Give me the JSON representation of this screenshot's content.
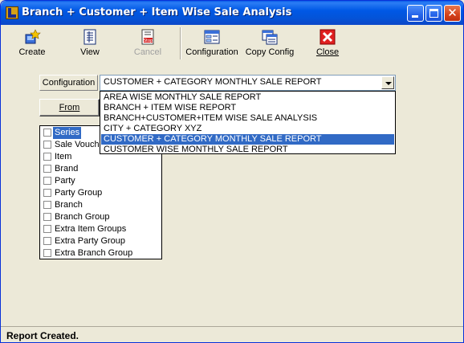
{
  "window": {
    "title": "Branch + Customer + Item Wise Sale Analysis"
  },
  "toolbar": {
    "create": "Create",
    "view": "View",
    "cancel": "Cancel",
    "configuration": "Configuration",
    "copy_config": "Copy Config",
    "close": "Close"
  },
  "config": {
    "label": "Configuration",
    "selected": "CUSTOMER + CATEGORY MONTHLY SALE REPORT",
    "options": [
      "AREA WISE MONTHLY SALE REPORT",
      "BRANCH + ITEM WISE REPORT",
      "BRANCH+CUSTOMER+ITEM WISE SALE ANALYSIS",
      "CITY + CATEGORY XYZ",
      "CUSTOMER + CATEGORY MONTHLY SALE REPORT",
      "CUSTOMER WISE MONTHLY SALE REPORT"
    ]
  },
  "from_button": "From",
  "fields": [
    "Series",
    "Sale Voucher",
    "Item",
    "Brand",
    "Party",
    "Party Group",
    "Branch",
    "Branch Group",
    "Extra Item Groups",
    "Extra Party Group",
    "Extra Branch Group"
  ],
  "status": "Report Created.",
  "colors": {
    "titlebar": "#0058e6",
    "selection": "#316ac5",
    "face": "#ece9d8"
  }
}
